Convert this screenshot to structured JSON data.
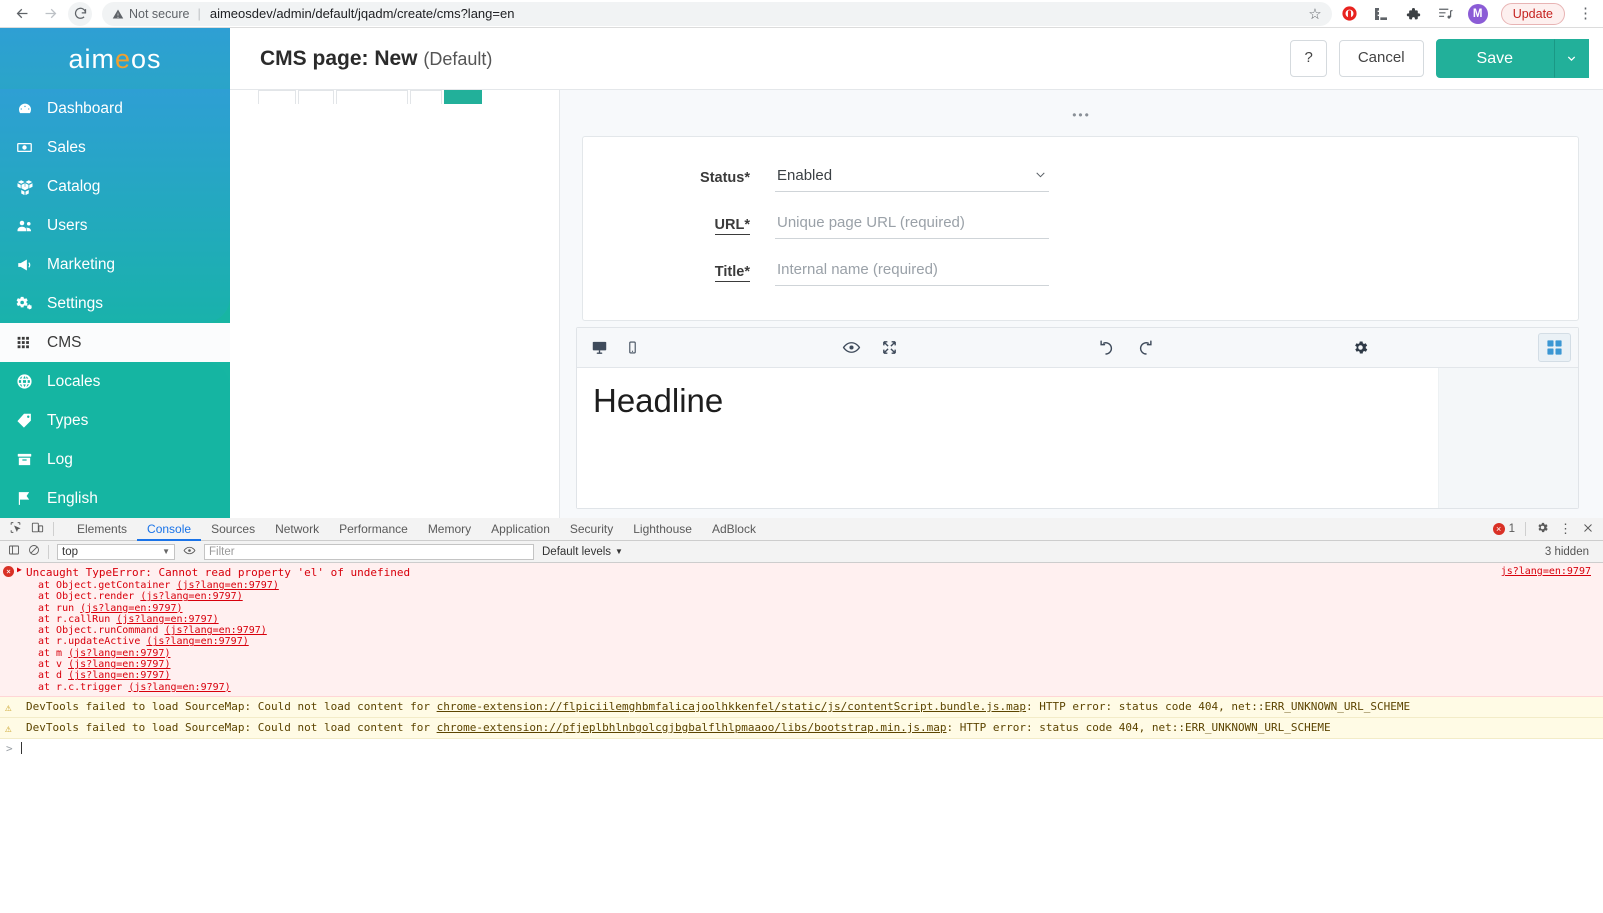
{
  "browser": {
    "back_icon": "arrow-left-icon",
    "forward_icon": "arrow-right-icon",
    "reload_icon": "reload-icon",
    "security_label": "Not secure",
    "url": "aimeosdev/admin/default/jqadm/create/cms?lang=en",
    "bookmark_icon": "star-icon",
    "extensions": [
      "adblock-icon",
      "ruler-icon",
      "puzzle-extension-icon",
      "reading-list-icon"
    ],
    "profile_initial": "M",
    "update_label": "Update",
    "menu_icon": "kebab-menu-icon"
  },
  "sidebar": {
    "logo": {
      "part1": "aim",
      "accent": "e",
      "part2": "os"
    },
    "items": [
      {
        "label": "Dashboard",
        "icon": "dashboard-icon",
        "active": false
      },
      {
        "label": "Sales",
        "icon": "money-bill-icon",
        "active": false
      },
      {
        "label": "Catalog",
        "icon": "boxes-icon",
        "active": false
      },
      {
        "label": "Users",
        "icon": "users-icon",
        "active": false
      },
      {
        "label": "Marketing",
        "icon": "bullhorn-icon",
        "active": false
      },
      {
        "label": "Settings",
        "icon": "gears-icon",
        "active": false
      },
      {
        "label": "CMS",
        "icon": "grid-icon",
        "active": true
      },
      {
        "label": "Locales",
        "icon": "globe-icon",
        "active": false
      },
      {
        "label": "Types",
        "icon": "tag-icon",
        "active": false
      },
      {
        "label": "Log",
        "icon": "archive-icon",
        "active": false
      },
      {
        "label": "English",
        "icon": "flag-icon",
        "active": false
      }
    ]
  },
  "header": {
    "title_main": "CMS page: New",
    "title_suffix": "(Default)",
    "help_label": "?",
    "cancel_label": "Cancel",
    "save_label": "Save",
    "save_caret_icon": "chevron-down-icon"
  },
  "form": {
    "drag_handle_icon": "drag-dots-icon",
    "fields": [
      {
        "label": "Status*",
        "underline": false,
        "type": "select",
        "value": "Enabled",
        "placeholder": ""
      },
      {
        "label": "URL*",
        "underline": true,
        "type": "text",
        "value": "",
        "placeholder": "Unique page URL (required)"
      },
      {
        "label": "Title*",
        "underline": true,
        "type": "text",
        "value": "",
        "placeholder": "Internal name (required)"
      }
    ]
  },
  "editor": {
    "toolbar": {
      "desktop_icon": "desktop-icon",
      "mobile_icon": "mobile-icon",
      "preview_icon": "eye-icon",
      "fullscreen_icon": "expand-arrows-icon",
      "undo_icon": "undo-icon",
      "redo_icon": "redo-icon",
      "settings_icon": "gear-icon",
      "blocks_icon": "blocks-grid-icon"
    },
    "content_headline": "Headline"
  },
  "devtools": {
    "tabs": [
      "Elements",
      "Console",
      "Sources",
      "Network",
      "Performance",
      "Memory",
      "Application",
      "Security",
      "Lighthouse",
      "AdBlock"
    ],
    "active_tab": "Console",
    "inspect_icon": "inspect-element-icon",
    "device_icon": "device-toolbar-icon",
    "error_count": "1",
    "error_badge_icon": "error-circle-icon",
    "settings_icon": "gear-icon",
    "menu_icon": "kebab-menu-icon",
    "close_icon": "close-icon",
    "console_toolbar": {
      "sidebar_icon": "console-sidebar-icon",
      "clear_icon": "clear-console-icon",
      "context": "top",
      "context_caret": "chevron-down-icon",
      "eye_icon": "live-expression-icon",
      "filter_placeholder": "Filter",
      "levels_label": "Default levels",
      "levels_caret": "chevron-down-icon",
      "hidden_label": "3 hidden"
    },
    "console_messages": [
      {
        "type": "error",
        "title": "Uncaught TypeError: Cannot read property 'el' of undefined",
        "source": "js?lang=en:9797",
        "stack": [
          {
            "fn": "at Object.getContainer",
            "loc": "(js?lang=en:9797)"
          },
          {
            "fn": "at Object.render",
            "loc": "(js?lang=en:9797)"
          },
          {
            "fn": "at run",
            "loc": "(js?lang=en:9797)"
          },
          {
            "fn": "at r.callRun",
            "loc": "(js?lang=en:9797)"
          },
          {
            "fn": "at Object.runCommand",
            "loc": "(js?lang=en:9797)"
          },
          {
            "fn": "at r.updateActive",
            "loc": "(js?lang=en:9797)"
          },
          {
            "fn": "at m",
            "loc": "(js?lang=en:9797)"
          },
          {
            "fn": "at v",
            "loc": "(js?lang=en:9797)"
          },
          {
            "fn": "at d",
            "loc": "(js?lang=en:9797)"
          },
          {
            "fn": "at r.c.trigger",
            "loc": "(js?lang=en:9797)"
          }
        ]
      },
      {
        "type": "warning",
        "prefix": "DevTools failed to load SourceMap: Could not load content for ",
        "link": "chrome-extension://flpiciilemghbmfalicajoolhkkenfel/static/js/contentScript.bundle.js.map",
        "suffix": ": HTTP error: status code 404, net::ERR_UNKNOWN_URL_SCHEME"
      },
      {
        "type": "warning",
        "prefix": "DevTools failed to load SourceMap: Could not load content for ",
        "link": "chrome-extension://pfjeplbhlnbgolcgjbgbalflhlpmaaoo/libs/bootstrap.min.js.map",
        "suffix": ": HTTP error: status code 404, net::ERR_UNKNOWN_URL_SCHEME"
      }
    ],
    "prompt_caret": ">"
  },
  "colors": {
    "accent_teal": "#22b09a",
    "sidebar_top": "#2e9fd4",
    "sidebar_bottom": "#15b7a0",
    "logo_accent": "#f0a030",
    "error_red": "#d8000c",
    "warn_yellow": "#fffbe5",
    "devtools_blue": "#1a73e8"
  }
}
